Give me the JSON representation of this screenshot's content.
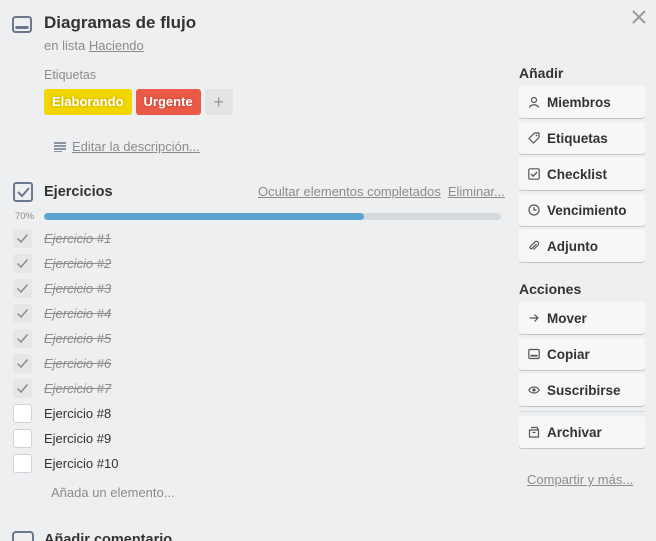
{
  "card": {
    "title": "Diagramas de flujo",
    "in_list_prefix": "en lista",
    "list_name": "Haciendo"
  },
  "labels": {
    "heading": "Etiquetas",
    "items": [
      {
        "text": "Elaborando",
        "color": "#f2d600"
      },
      {
        "text": "Urgente",
        "color": "#eb5a46"
      }
    ],
    "add_symbol": "+"
  },
  "description": {
    "edit_link": "Editar la descripción..."
  },
  "checklist": {
    "title": "Ejercicios",
    "hide_completed": "Ocultar elementos completados",
    "delete": "Eliminar...",
    "progress_label": "70%",
    "progress_fraction": 0.7,
    "progress_color": "#5ba4cf",
    "items": [
      {
        "text": "Ejercicio #1",
        "done": true
      },
      {
        "text": "Ejercicio #2",
        "done": true
      },
      {
        "text": "Ejercicio #3",
        "done": true
      },
      {
        "text": "Ejercicio #4",
        "done": true
      },
      {
        "text": "Ejercicio #5",
        "done": true
      },
      {
        "text": "Ejercicio #6",
        "done": true
      },
      {
        "text": "Ejercicio #7",
        "done": true
      },
      {
        "text": "Ejercicio #8",
        "done": false
      },
      {
        "text": "Ejercicio #9",
        "done": false
      },
      {
        "text": "Ejercicio #10",
        "done": false
      }
    ],
    "add_item": "Añada un elemento..."
  },
  "comment": {
    "title": "Añadir comentario"
  },
  "sidebar": {
    "add_heading": "Añadir",
    "add_buttons": [
      {
        "label": "Miembros",
        "icon": "person-icon"
      },
      {
        "label": "Etiquetas",
        "icon": "tag-icon"
      },
      {
        "label": "Checklist",
        "icon": "checkbox-icon"
      },
      {
        "label": "Vencimiento",
        "icon": "clock-icon"
      },
      {
        "label": "Adjunto",
        "icon": "paperclip-icon"
      }
    ],
    "actions_heading": "Acciones",
    "action_buttons": [
      {
        "label": "Mover",
        "icon": "arrow-right-icon"
      },
      {
        "label": "Copiar",
        "icon": "card-icon"
      },
      {
        "label": "Suscribirse",
        "icon": "eye-icon"
      },
      {
        "label": "Archivar",
        "icon": "archive-icon"
      }
    ],
    "share_link": "Compartir y más..."
  }
}
